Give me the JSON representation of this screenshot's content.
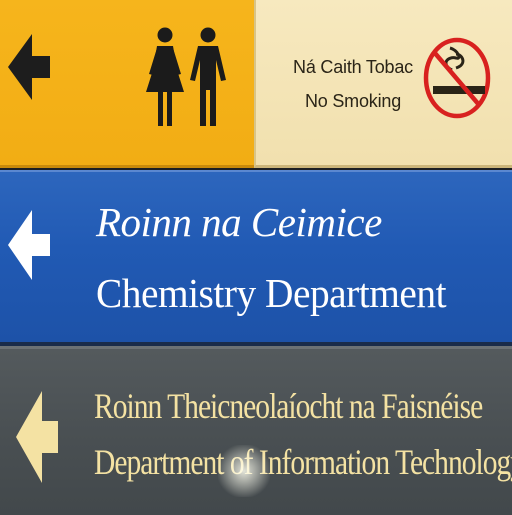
{
  "signs": {
    "toilets": {
      "background": "#f2ad14",
      "arrow_icon": "arrow-left-icon",
      "arrow_color": "#1d1d1d",
      "figures_icon": "toilets-icon"
    },
    "no_smoking": {
      "irish": "Ná Caith Tobac",
      "english": "No Smoking",
      "icon": "no-smoking-icon",
      "prohibition_color": "#d8211f"
    },
    "chemistry": {
      "background": "#215ab4",
      "arrow_icon": "arrow-left-icon",
      "arrow_color": "#ffffff",
      "irish": "Roinn na Ceimice",
      "english": "Chemistry Department"
    },
    "information_technology": {
      "background": "#4a5053",
      "arrow_icon": "arrow-left-icon",
      "arrow_color": "#f4e2a3",
      "irish": "Roinn Theicneolaíocht na Faisnéise",
      "english": "Department of Information Technology"
    }
  }
}
